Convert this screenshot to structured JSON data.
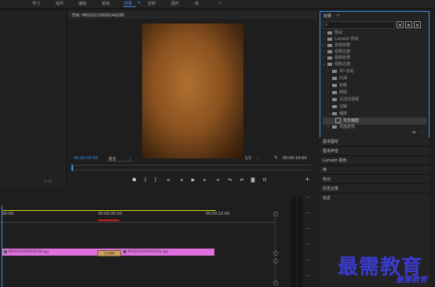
{
  "workspaces": [
    "学习",
    "组件",
    "编辑",
    "颜色",
    "效果",
    "音频",
    "图形",
    "库"
  ],
  "workspace_active_index": 4,
  "workspace_more": "»",
  "monitor": {
    "title": "节目: IMG20210926140202",
    "menu_icon": "≡",
    "timecode_current": "00:00:00:00",
    "fit": "适合",
    "resolution": "1/2",
    "timecode_duration": "00:00:10:00"
  },
  "transport": [
    "marker",
    "in",
    "out",
    "goto-in",
    "step-back",
    "play",
    "step-forward",
    "goto-out",
    "insert",
    "overwrite",
    "export-frame",
    "button-editor"
  ],
  "effects": {
    "title": "效果",
    "menu_icon": "≡",
    "search_placeholder": "",
    "tree": [
      {
        "label": "预设",
        "indent": 0,
        "expanded": false
      },
      {
        "label": "Lumetri 预设",
        "indent": 0,
        "expanded": false
      },
      {
        "label": "音频效果",
        "indent": 0,
        "expanded": false
      },
      {
        "label": "音频过渡",
        "indent": 0,
        "expanded": false
      },
      {
        "label": "视频效果",
        "indent": 0,
        "expanded": false
      },
      {
        "label": "视频过渡",
        "indent": 0,
        "expanded": true
      },
      {
        "label": "3D 运动",
        "indent": 1,
        "expanded": false
      },
      {
        "label": "内滑",
        "indent": 1,
        "expanded": false
      },
      {
        "label": "划像",
        "indent": 1,
        "expanded": false
      },
      {
        "label": "擦除",
        "indent": 1,
        "expanded": false
      },
      {
        "label": "沉浸式视频",
        "indent": 1,
        "expanded": false
      },
      {
        "label": "溶解",
        "indent": 1,
        "expanded": false
      },
      {
        "label": "缩放",
        "indent": 1,
        "expanded": true
      },
      {
        "label": "交叉缩放",
        "indent": 2,
        "selected": true
      },
      {
        "label": "页面剥落",
        "indent": 1,
        "expanded": false
      }
    ]
  },
  "side_tabs": [
    "基本图形",
    "基本声音",
    "Lumetri 颜色",
    "库",
    "标记",
    "历史记录",
    "信息"
  ],
  "timeline": {
    "tc_start": "00:00",
    "tc_mid": "00:00:05:00",
    "tc_end": "00:00:10:00",
    "clips": [
      "IMG20210926140156.jpg",
      "IMG20210926140202.jpg"
    ],
    "transition": "交叉缩放"
  },
  "lower_left_icons": "≡ ⊡",
  "watermark": {
    "main": "最需教育",
    "sub": "最需教育"
  }
}
